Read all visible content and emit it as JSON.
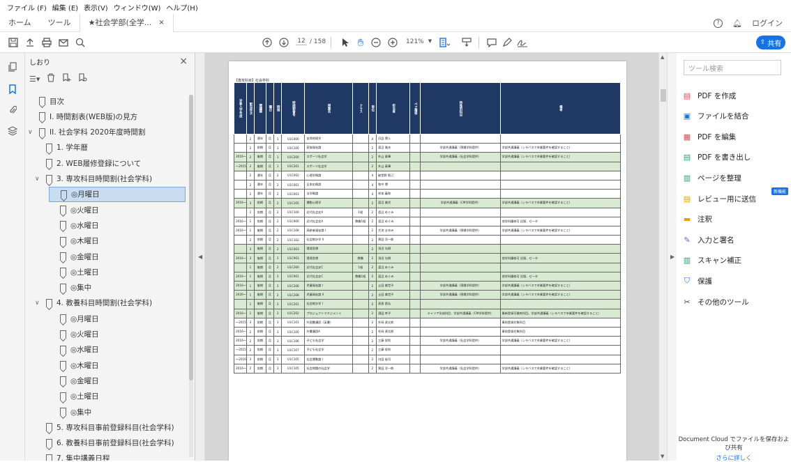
{
  "menu": [
    "ファイル (F)",
    "編集 (E)",
    "表示(V)",
    "ウィンドウ(W)",
    "ヘルプ(H)"
  ],
  "tabs": {
    "home": "ホーム",
    "tools": "ツール",
    "doc": "★社会学部(全学..."
  },
  "login": "ログイン",
  "toolbar": {
    "page_current": "12",
    "page_total": "/ 158",
    "zoom": "121%",
    "share": "共有"
  },
  "bookmarks": {
    "title": "しおり",
    "items": [
      {
        "label": "目次",
        "level": 0
      },
      {
        "label": "I. 時間割表(WEB版)の見方",
        "level": 0
      },
      {
        "label": "II. 社会学科 2020年度時間割",
        "level": 0
      },
      {
        "label": "1. 学年暦",
        "level": 1
      },
      {
        "label": "2. WEB履修登録について",
        "level": 1
      },
      {
        "label": "3. 専攻科目時間割(社会学科)",
        "level": 1
      },
      {
        "label": "◎月曜日",
        "level": 2
      },
      {
        "label": "◎火曜日",
        "level": 2
      },
      {
        "label": "◎水曜日",
        "level": 2
      },
      {
        "label": "◎木曜日",
        "level": 2
      },
      {
        "label": "◎金曜日",
        "level": 2
      },
      {
        "label": "◎土曜日",
        "level": 2
      },
      {
        "label": "◎集中",
        "level": 2
      },
      {
        "label": "4. 教養科目時間割(社会学科)",
        "level": 1
      },
      {
        "label": "◎月曜日",
        "level": 2
      },
      {
        "label": "◎火曜日",
        "level": 2
      },
      {
        "label": "◎水曜日",
        "level": 2
      },
      {
        "label": "◎木曜日",
        "level": 2
      },
      {
        "label": "◎金曜日",
        "level": 2
      },
      {
        "label": "◎土曜日",
        "level": 2
      },
      {
        "label": "◎集中",
        "level": 2
      },
      {
        "label": "5. 専攻科目事前登録科目(社会学科)",
        "level": 1
      },
      {
        "label": "6. 教養科目事前登録科目(社会学科)",
        "level": 1
      },
      {
        "label": "7. 集中講義日程",
        "level": 1
      }
    ]
  },
  "doc": {
    "section_title": "【専攻科目】社会学科",
    "headers": [
      "対象入学年度",
      "配当年次",
      "開講期",
      "曜日",
      "時限",
      "時間割番号",
      "授業名",
      "クラス",
      "単位",
      "担当者",
      "ペア履修",
      "特殊的科目",
      "備考"
    ],
    "rows": [
      [
        "",
        "2",
        "通年",
        "月",
        "1",
        "U1C000",
        "自然地理学",
        "",
        "4",
        "浜田 博入",
        "",
        "",
        ""
      ],
      [
        "",
        "2",
        "前期",
        "月",
        "1",
        "U1C100",
        "家族福祉論",
        "",
        "2",
        "渡辺 雅夫",
        "",
        "学部共通講義（現場学科提供）",
        "学部共通講義（シラバスで卒業要件を確認すること）"
      ],
      [
        "2016〜",
        "2",
        "後期",
        "月",
        "1",
        "U1C200",
        "スポーツ社会学",
        "",
        "2",
        "外山 泰輝",
        "",
        "学部共通講義（社会学科提供）",
        "学部共通講義（シラバスで卒業要件を確認すること）"
      ],
      [
        "〜2015",
        "2",
        "後期",
        "月",
        "1",
        "U1C201",
        "スポーツ社会学",
        "",
        "2",
        "外山 泰輝",
        "",
        "",
        ""
      ],
      [
        "",
        "2",
        "通年",
        "月",
        "2",
        "U1C002",
        "心理学概論",
        "",
        "4",
        "破堂野 智己",
        "",
        "",
        ""
      ],
      [
        "",
        "2",
        "通年",
        "月",
        "2",
        "U1C001",
        "日本史概説",
        "",
        "4",
        "和中 博",
        "",
        "",
        ""
      ],
      [
        "",
        "2",
        "通年",
        "月",
        "2",
        "U1C003",
        "法学概論",
        "",
        "4",
        "岸本 義和",
        "",
        "",
        ""
      ],
      [
        "2016〜",
        "3",
        "前期",
        "月",
        "2",
        "U1C105",
        "運動心理学",
        "",
        "2",
        "渡辺 美児",
        "",
        "学部共通講義（CM学科提供）",
        "学部共通講義（シラバスで卒業要件を確認すること）"
      ],
      [
        "",
        "1",
        "前期",
        "月",
        "2",
        "U1C100",
        "近代社会史A",
        "1組",
        "2",
        "渡辺 めぐみ",
        "",
        "",
        ""
      ],
      [
        "2016〜",
        "1",
        "前期",
        "月",
        "2",
        "U1C900",
        "近代社会史A",
        "教職1組",
        "2",
        "渡辺 めぐみ",
        "",
        "",
        "他学科履修可 旧版、ゼータ"
      ],
      [
        "2016〜",
        "1",
        "後期",
        "月",
        "2",
        "U1C108",
        "高齢者福祉論 I",
        "",
        "2",
        "大池 まゆみ",
        "",
        "学部共通講義（現場学科提供）",
        "学部共通講義（シラバスで卒業要件を確認すること）"
      ],
      [
        "",
        "2",
        "前期",
        "月",
        "2",
        "U1C102",
        "社会統計学 II",
        "",
        "2",
        "黒田 洋一郎",
        "",
        "",
        ""
      ],
      [
        "",
        "3",
        "後期",
        "月",
        "2",
        "U1C003",
        "環境思想",
        "",
        "2",
        "浅沼 光樹",
        "",
        "",
        ""
      ],
      [
        "2016〜",
        "3",
        "後期",
        "月",
        "2",
        "U1C903",
        "環境思想",
        "教職",
        "2",
        "浅沼 光樹",
        "",
        "",
        "他学科履修可 旧版、ゼータ"
      ],
      [
        "",
        "1",
        "後期",
        "月",
        "2",
        "U1C200",
        "近代社会史C",
        "1組",
        "2",
        "渡辺 めぐみ",
        "",
        "",
        ""
      ],
      [
        "2016〜",
        "1",
        "後期",
        "月",
        "2",
        "U1C901",
        "近代社会史C",
        "教職1組",
        "2",
        "渡辺 めぐみ",
        "",
        "",
        "他学科履修可 旧版、ゼータ"
      ],
      [
        "2016〜",
        "1",
        "後期",
        "月",
        "2",
        "U1C206",
        "児童福祉論 I",
        "",
        "2",
        "土田 美世子",
        "",
        "学部共通講義（現場学科提供）",
        "学部共通講義（シラバスで卒業要件を確認すること）"
      ],
      [
        "2020〜",
        "1",
        "後期",
        "月",
        "2",
        "U1C208",
        "児童福祉論 II",
        "",
        "2",
        "土田 美世子",
        "",
        "学部共通講義（現場学科提供）",
        "学部共通講義（シラバスで卒業要件を確認すること）"
      ],
      [
        "",
        "1",
        "後期",
        "月",
        "2",
        "U1C201",
        "社会統計学 I",
        "",
        "2",
        "清島 昌弘",
        "",
        "",
        ""
      ],
      [
        "2016〜",
        "1",
        "後期",
        "月",
        "2",
        "U1C202",
        "プロジェクトマネジメント",
        "",
        "2",
        "濱田 幸子",
        "",
        "キャリア形成科目、学部共通講義（CM学科提供）",
        "最新登録可最終科目。学部共通講義（シラバスで卒業要件を確認すること）"
      ],
      [
        "〜2015",
        "3",
        "前期",
        "月",
        "3",
        "U1C101",
        "外国書講読（英書）",
        "",
        "2",
        "外岡 源太郎",
        "",
        "",
        "事前登録対象科目"
      ],
      [
        "2016〜",
        "2",
        "前期",
        "月",
        "3",
        "U1C100",
        "外書講読A",
        "",
        "2",
        "外岡 源太郎",
        "",
        "",
        "事前登録対象科目"
      ],
      [
        "2016〜",
        "2",
        "前期",
        "月",
        "3",
        "U1C106",
        "子ども社会学",
        "",
        "2",
        "三藤 保利",
        "",
        "学部共通講義（社会学科提供）",
        "学部共通講義（シラバスで卒業要件を確認すること）"
      ],
      [
        "〜2015",
        "2",
        "前期",
        "月",
        "3",
        "U1C107",
        "子ども社会学",
        "",
        "2",
        "三藤 保利",
        "",
        "",
        ""
      ],
      [
        "〜2016",
        "3",
        "前期",
        "月",
        "3",
        "U1C105",
        "社会運動論 I",
        "",
        "2",
        "口田 省司",
        "",
        "",
        ""
      ],
      [
        "2016〜",
        "2",
        "前期",
        "月",
        "3",
        "U1C105",
        "社会問題の社会学",
        "",
        "2",
        "黒田 洋一郎",
        "",
        "学部共通講義（社会学科提供）",
        "学部共通講義（シラバスで卒業要件を確認すること）"
      ]
    ],
    "green_rows": [
      2,
      3,
      7,
      12,
      13,
      14,
      15,
      16,
      17,
      18,
      19
    ]
  },
  "tools": {
    "search_placeholder": "ツール検索",
    "items": [
      {
        "label": "PDF を作成",
        "icon": "create-pdf-icon",
        "color": "#e34850"
      },
      {
        "label": "ファイルを結合",
        "icon": "combine-files-icon",
        "color": "#1473e6"
      },
      {
        "label": "PDF を編集",
        "icon": "edit-pdf-icon",
        "color": "#e34850"
      },
      {
        "label": "PDF を書き出し",
        "icon": "export-pdf-icon",
        "color": "#28a070"
      },
      {
        "label": "ページを整理",
        "icon": "organize-pages-icon",
        "color": "#28a070"
      },
      {
        "label": "レビュー用に送信",
        "icon": "send-review-icon",
        "color": "#e8a300"
      },
      {
        "label": "注釈",
        "icon": "comment-icon",
        "color": "#e8a300"
      },
      {
        "label": "入力と署名",
        "icon": "fill-sign-icon",
        "color": "#7b52c9"
      },
      {
        "label": "スキャン補正",
        "icon": "scan-icon",
        "color": "#28a070"
      },
      {
        "label": "保護",
        "icon": "protect-icon",
        "color": "#1473e6"
      },
      {
        "label": "その他のツール",
        "icon": "more-tools-icon",
        "color": "#444"
      }
    ],
    "badge": "新機能",
    "footer_text": "Document Cloud でファイルを保存および共有",
    "footer_link": "さらに詳しく"
  }
}
